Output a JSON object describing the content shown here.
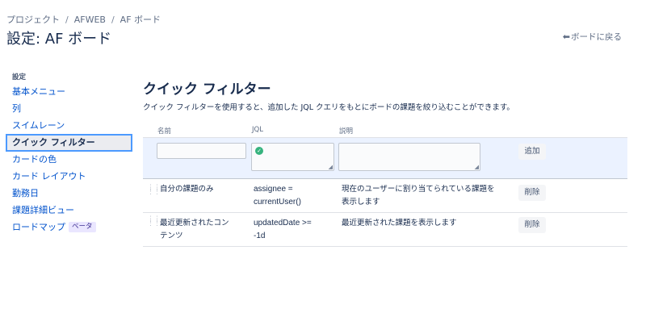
{
  "breadcrumb": {
    "items": [
      "プロジェクト",
      "AFWEB",
      "AF ボード"
    ],
    "separator": "/"
  },
  "page_title": "設定: AF ボード",
  "back_link": {
    "icon": "arrow-left-icon",
    "label": "ボードに戻る"
  },
  "sidebar": {
    "heading": "設定",
    "items": [
      {
        "label": "基本メニュー"
      },
      {
        "label": "列"
      },
      {
        "label": "スイムレーン"
      },
      {
        "label": "クイック フィルター",
        "active": true
      },
      {
        "label": "カードの色"
      },
      {
        "label": "カード レイアウト"
      },
      {
        "label": "勤務日"
      },
      {
        "label": "課題詳細ビュー"
      },
      {
        "label": "ロードマップ",
        "badge": "ベータ"
      }
    ]
  },
  "main": {
    "title": "クイック フィルター",
    "description": "クイック フィルターを使用すると、追加した JQL クエリをもとにボードの課題を絞り込むことができます。",
    "columns": {
      "name": "名前",
      "jql": "JQL",
      "description": "説明"
    },
    "form": {
      "name_value": "",
      "jql_value": "",
      "description_value": "",
      "jql_status_icon": "check-circle-icon",
      "add_button": "追加"
    },
    "filters": [
      {
        "name_lines": [
          "自分の課題のみ"
        ],
        "jql_lines": [
          "assignee =",
          "currentUser()"
        ],
        "description_lines": [
          "現在のユーザーに割り当てられている課題を",
          "表示します"
        ],
        "delete_button": "削除"
      },
      {
        "name_lines": [
          "最近更新されたコン",
          "テンツ"
        ],
        "jql_lines": [
          "updatedDate >=",
          "-1d"
        ],
        "description_lines": [
          "最近更新された課題を表示します"
        ],
        "delete_button": "削除"
      }
    ]
  },
  "colors": {
    "link": "#0052cc",
    "active_border": "#4c9aff",
    "form_background": "#ebf2ff",
    "success": "#36b37e",
    "badge_bg": "#eae6ff"
  }
}
